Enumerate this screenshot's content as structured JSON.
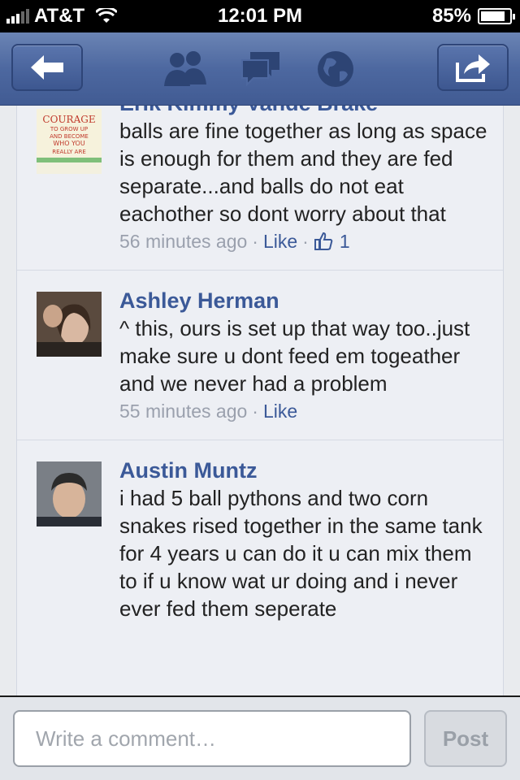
{
  "status_bar": {
    "carrier": "AT&T",
    "time": "12:01 PM",
    "battery": "85%",
    "battery_level": 0.85
  },
  "nav": {
    "back_icon": "back-arrow-icon",
    "friends_icon": "friends-icon",
    "messages_icon": "messages-icon",
    "notifications_icon": "globe-icon",
    "share_icon": "share-icon"
  },
  "comments": [
    {
      "name": "Erik Kimmy Vande Brake",
      "text": "balls are fine together as long as space is enough for them and they are fed separate...and balls do not eat eachother so dont worry about that",
      "time": "56 minutes ago",
      "like": "Like",
      "likes": "1",
      "avatar_lines": [
        "COURAGE",
        "TO GROW UP",
        "AND BECOME",
        "WHO YOU",
        "REALLY ARE"
      ]
    },
    {
      "name": "Ashley Herman",
      "text": "^ this, ours is set up that way too..just make sure u dont feed em togeather and we never had a problem",
      "time": "55 minutes ago",
      "like": "Like"
    },
    {
      "name": "Austin Muntz",
      "text": "i had 5 ball pythons and two corn snakes rised together in the same tank for 4 years u can do it u can mix them to if u know wat ur doing and i never ever fed them seperate",
      "time": "",
      "like": ""
    }
  ],
  "compose": {
    "placeholder": "Write a comment…",
    "post_label": "Post"
  },
  "colors": {
    "nav": "#4d68a0",
    "link": "#3b5998",
    "feed_bg": "#edeff4"
  }
}
